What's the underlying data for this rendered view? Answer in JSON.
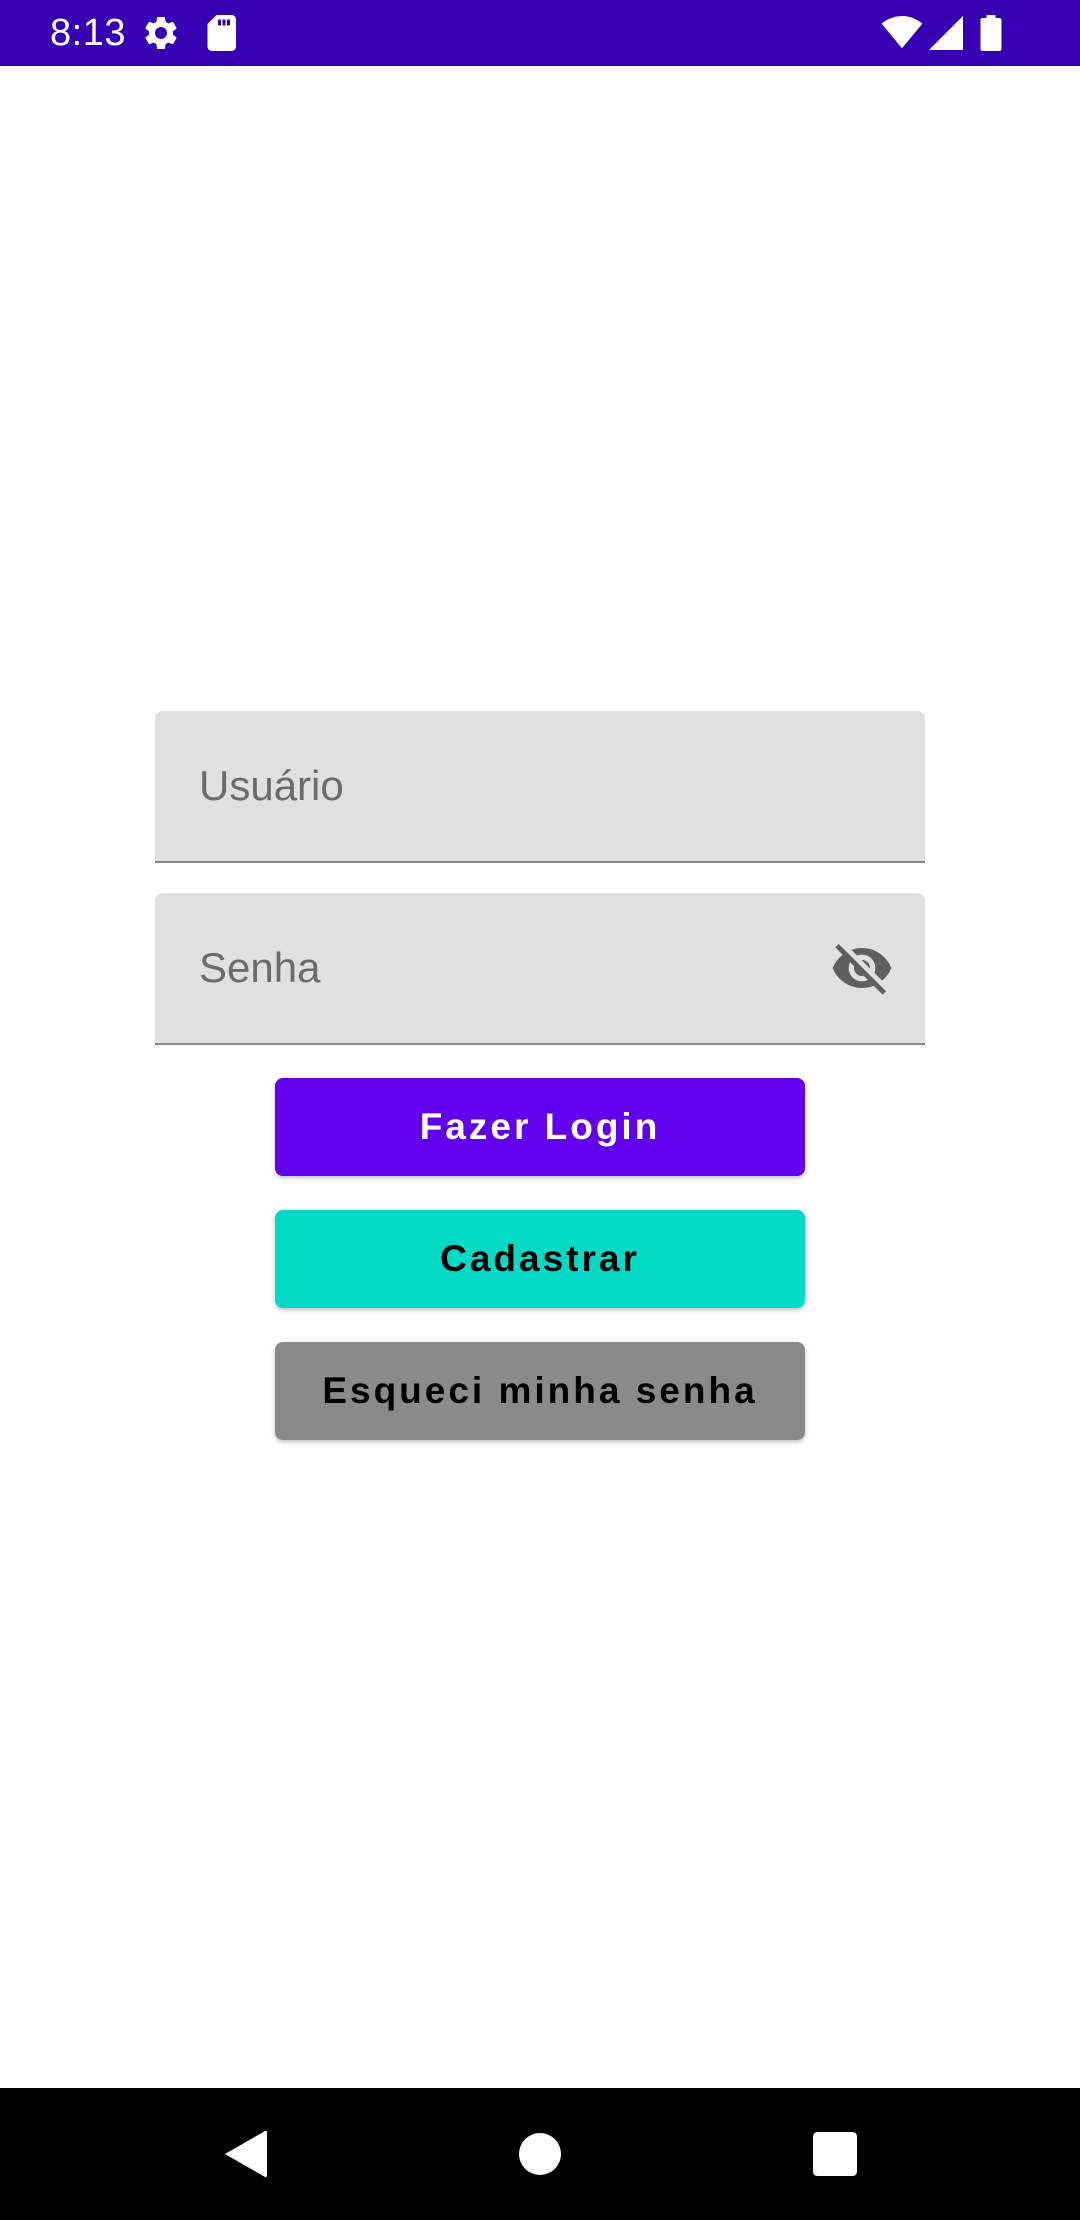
{
  "status_bar": {
    "time": "8:13",
    "background": "#3700B3",
    "icons": [
      "settings-icon",
      "sd-card-icon",
      "wifi-icon",
      "cellular-signal-icon",
      "battery-icon"
    ]
  },
  "login_form": {
    "username": {
      "placeholder": "Usuário",
      "value": ""
    },
    "password": {
      "placeholder": "Senha",
      "value": "",
      "toggle_icon": "visibility-off-icon"
    },
    "buttons": {
      "login": {
        "label": "Fazer Login",
        "background": "#6200EE",
        "color": "#FFFFFF"
      },
      "register": {
        "label": "Cadastrar",
        "background": "#03DAC5",
        "color": "#000000"
      },
      "forgot_password": {
        "label": "Esqueci minha senha",
        "background": "#8A8A8A",
        "color": "#000000"
      }
    }
  },
  "navigation_bar": {
    "background": "#000000",
    "buttons": [
      "back-icon",
      "home-icon",
      "recents-icon"
    ]
  }
}
